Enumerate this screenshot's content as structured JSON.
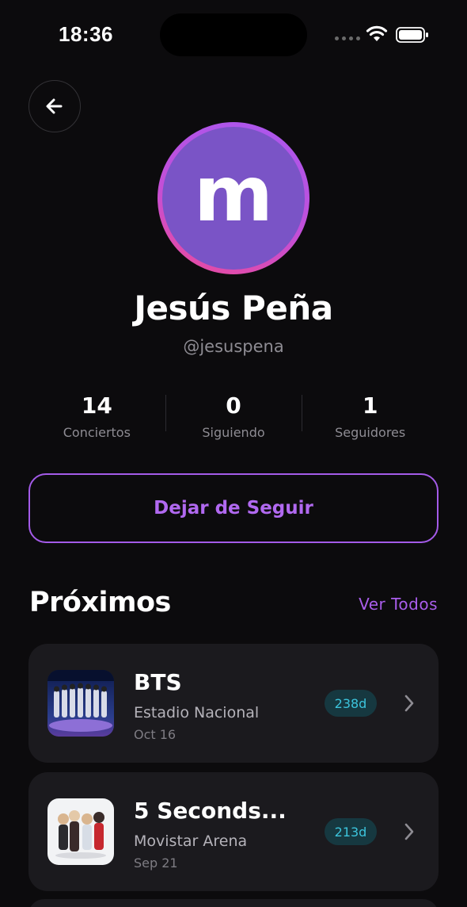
{
  "status_bar": {
    "time": "18:36",
    "icons": [
      "signal-icon",
      "wifi-icon",
      "battery-icon"
    ]
  },
  "header": {
    "back_icon": "arrow-left-icon"
  },
  "profile": {
    "avatar_letter": "m",
    "name": "Jesús Peña",
    "handle": "@jesuspena",
    "avatar_color": "#7a54c6",
    "ring_colors": [
      "#a858f0",
      "#ec4a9a"
    ]
  },
  "stats": [
    {
      "value": "14",
      "label": "Conciertos"
    },
    {
      "value": "0",
      "label": "Siguiendo"
    },
    {
      "value": "1",
      "label": "Seguidores"
    }
  ],
  "actions": {
    "unfollow_label": "Dejar de Seguir",
    "accent": "#a45be8"
  },
  "upcoming": {
    "title": "Próximos",
    "see_all": "Ver Todos",
    "events": [
      {
        "title": "BTS",
        "venue": "Estadio Nacional",
        "date": "Oct 16",
        "countdown": "238d",
        "thumb_icon": "band-photo-icon"
      },
      {
        "title": "5 Seconds...",
        "venue": "Movistar Arena",
        "date": "Sep 21",
        "countdown": "213d",
        "thumb_icon": "band-photo-icon"
      }
    ]
  }
}
